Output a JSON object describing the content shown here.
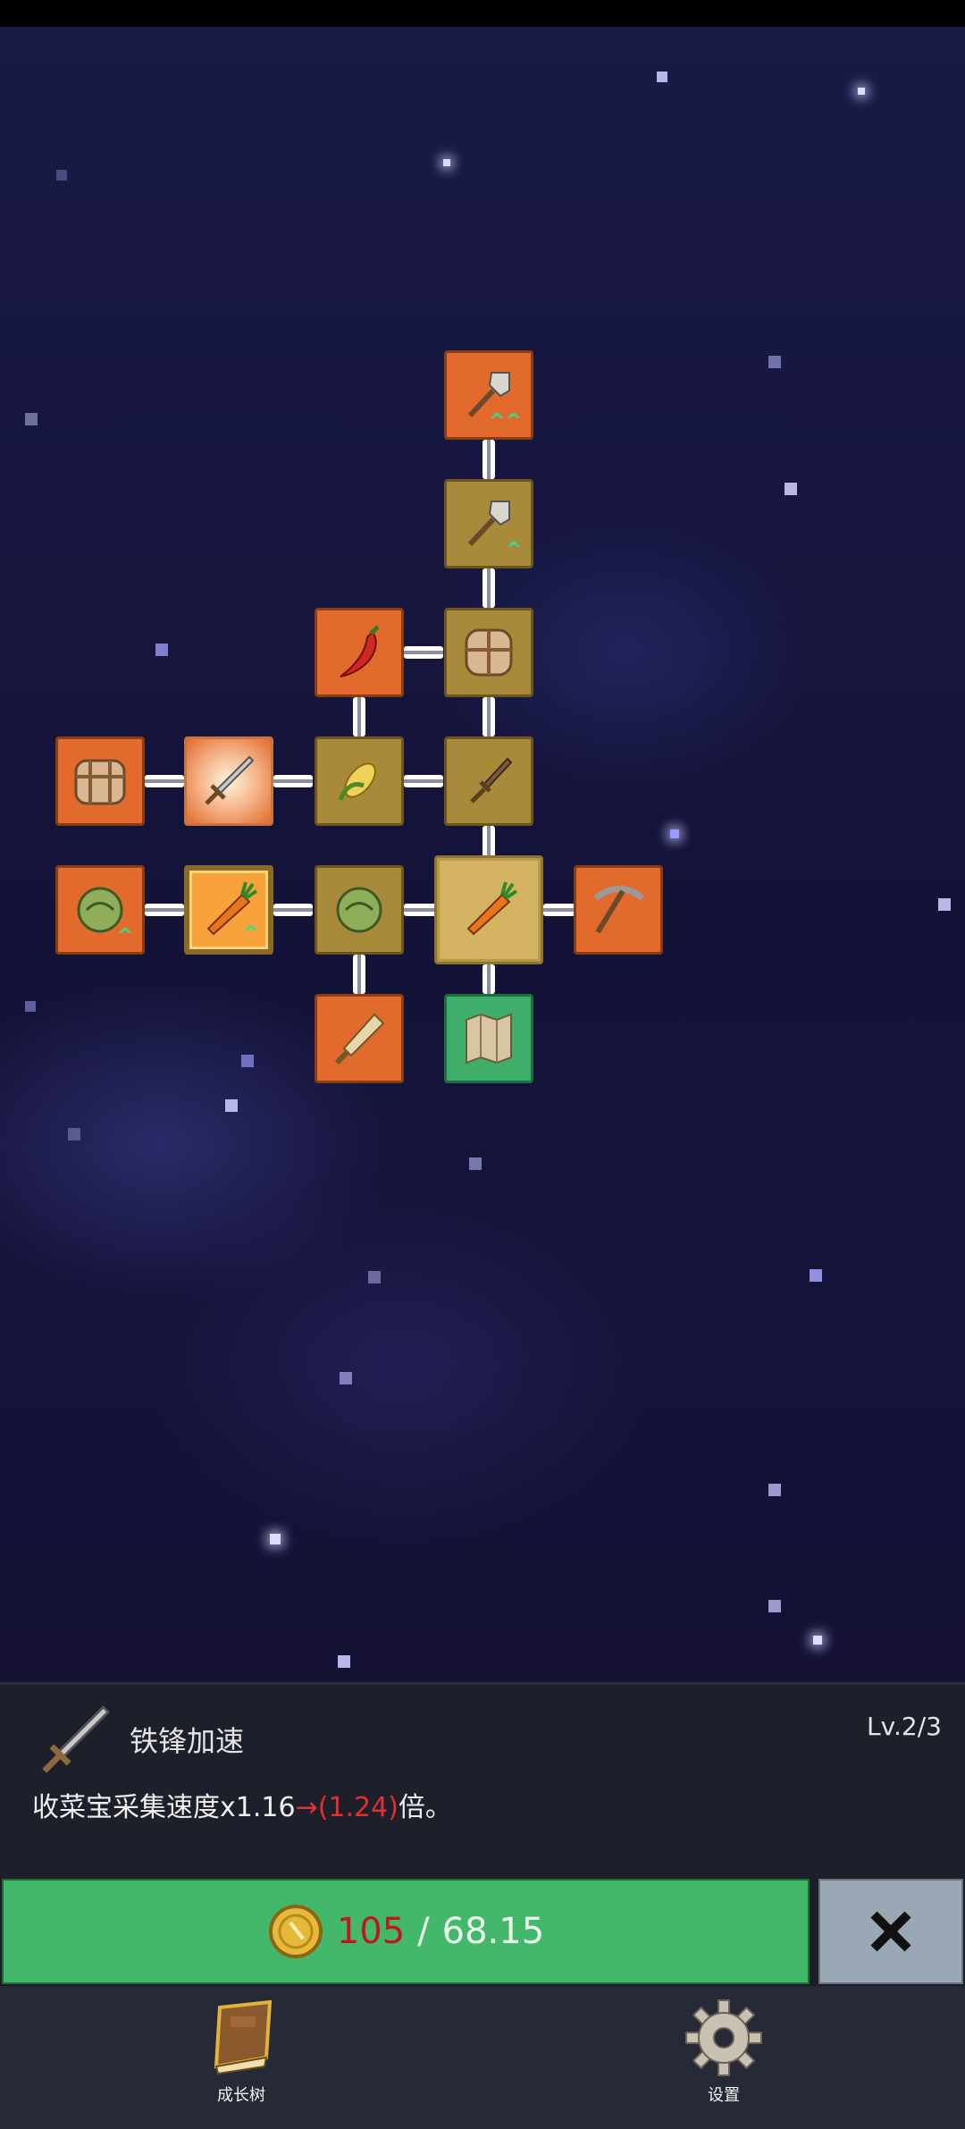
{
  "skill_tree": {
    "nodes": [
      {
        "name": "shovel-upgrade",
        "icon": "shovel-icon",
        "style": "orange",
        "upgrade_marker": "^^"
      },
      {
        "name": "shovel",
        "icon": "shovel-icon",
        "style": "tan",
        "upgrade_marker": "^"
      },
      {
        "name": "chili-pepper",
        "icon": "chili-pepper-icon",
        "style": "orange"
      },
      {
        "name": "backpack",
        "icon": "backpack-icon",
        "style": "tan"
      },
      {
        "name": "chest",
        "icon": "chest-icon",
        "style": "orange"
      },
      {
        "name": "iron-sword",
        "icon": "sword-icon",
        "style": "glow"
      },
      {
        "name": "corn",
        "icon": "corn-icon",
        "style": "tan"
      },
      {
        "name": "dagger",
        "icon": "dagger-icon",
        "style": "tan"
      },
      {
        "name": "cabbage-upgrade",
        "icon": "cabbage-icon",
        "style": "orange",
        "upgrade_marker": "^"
      },
      {
        "name": "carrot-upgrade",
        "icon": "carrot-icon",
        "style": "highlight",
        "upgrade_marker": "^"
      },
      {
        "name": "cabbage",
        "icon": "cabbage-icon",
        "style": "tan"
      },
      {
        "name": "carrot",
        "icon": "carrot-icon",
        "style": "selected"
      },
      {
        "name": "pickaxe",
        "icon": "pickaxe-icon",
        "style": "orange"
      },
      {
        "name": "club",
        "icon": "club-icon",
        "style": "orange"
      },
      {
        "name": "map",
        "icon": "map-icon",
        "style": "green"
      }
    ]
  },
  "detail": {
    "icon": "sword-icon",
    "title": "铁锋加速",
    "level": "Lv.2/3",
    "desc_prefix": "收菜宝采集速度x1.16",
    "desc_arrow": "→(1.24)",
    "desc_suffix": "倍。"
  },
  "purchase": {
    "coin_icon": "coin-icon",
    "cost": "105",
    "separator": "/",
    "owned": "68.15"
  },
  "close_icon": "close-icon",
  "nav": {
    "left": {
      "icon": "book-icon",
      "label": "成长树"
    },
    "right": {
      "icon": "gear-icon",
      "label": "设置"
    }
  },
  "colors": {
    "accent_green": "#43b86a",
    "cost_red": "#c0171b",
    "node_orange": "#e26a2c",
    "node_tan": "#a9893a"
  }
}
